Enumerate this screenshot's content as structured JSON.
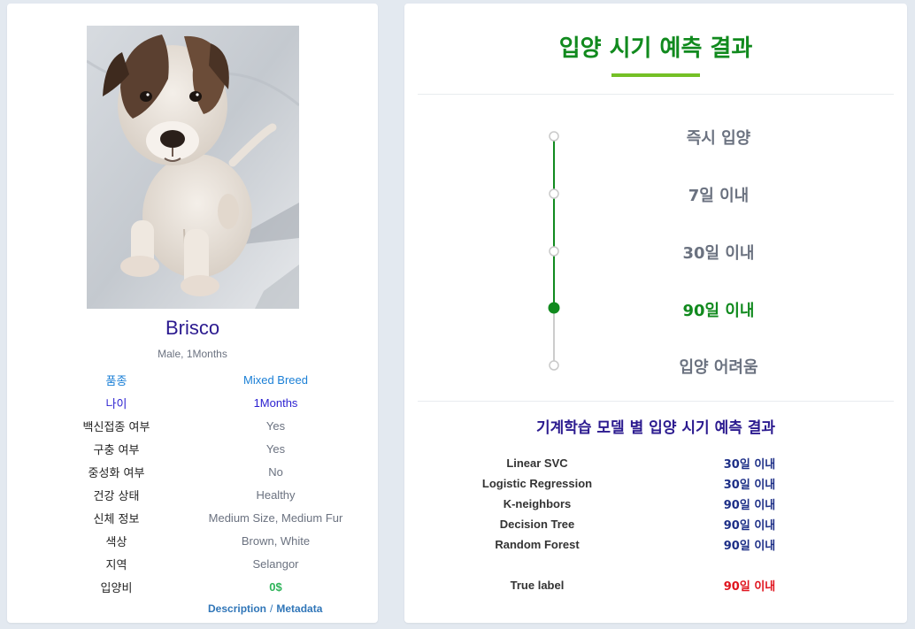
{
  "pet": {
    "name": "Brisco",
    "subtitle": "Male, 1Months",
    "info": [
      {
        "key": "품종",
        "value": "Mixed Breed"
      },
      {
        "key": "나이",
        "value": "1Months"
      },
      {
        "key": "백신접종 여부",
        "value": "Yes"
      },
      {
        "key": "구충 여부",
        "value": "Yes"
      },
      {
        "key": "중성화 여부",
        "value": "No"
      },
      {
        "key": "건강 상태",
        "value": "Healthy"
      },
      {
        "key": "신체 정보",
        "value": "Medium Size, Medium Fur"
      },
      {
        "key": "색상",
        "value": "Brown, White"
      },
      {
        "key": "지역",
        "value": "Selangor"
      },
      {
        "key": "입양비",
        "value": "0$"
      }
    ],
    "links": {
      "description": "Description",
      "separator": "/",
      "metadata": "Metadata"
    }
  },
  "result": {
    "title": "입양 시기 예측 결과",
    "timeline": [
      {
        "label": "즉시 입양",
        "active": false
      },
      {
        "label": "7일 이내",
        "active": false
      },
      {
        "label": "30일 이내",
        "active": false
      },
      {
        "label": "90일 이내",
        "active": true
      },
      {
        "label": "입양 어려움",
        "active": false
      }
    ],
    "ml_title": "기계학습 모델 별 입양 시기 예측 결과",
    "models": [
      {
        "model": "Linear SVC",
        "prediction": "30일 이내"
      },
      {
        "model": "Logistic Regression",
        "prediction": "30일 이내"
      },
      {
        "model": "K-neighbors",
        "prediction": "90일 이내"
      },
      {
        "model": "Decision Tree",
        "prediction": "90일 이내"
      },
      {
        "model": "Random Forest",
        "prediction": "90일 이내"
      }
    ],
    "true_label": {
      "model": "True label",
      "prediction": "90일 이내"
    }
  },
  "colors": {
    "accent_green": "#118a1e",
    "underline_green": "#74c026",
    "title_purple": "#2b1a8f",
    "true_red": "#e0141e"
  }
}
